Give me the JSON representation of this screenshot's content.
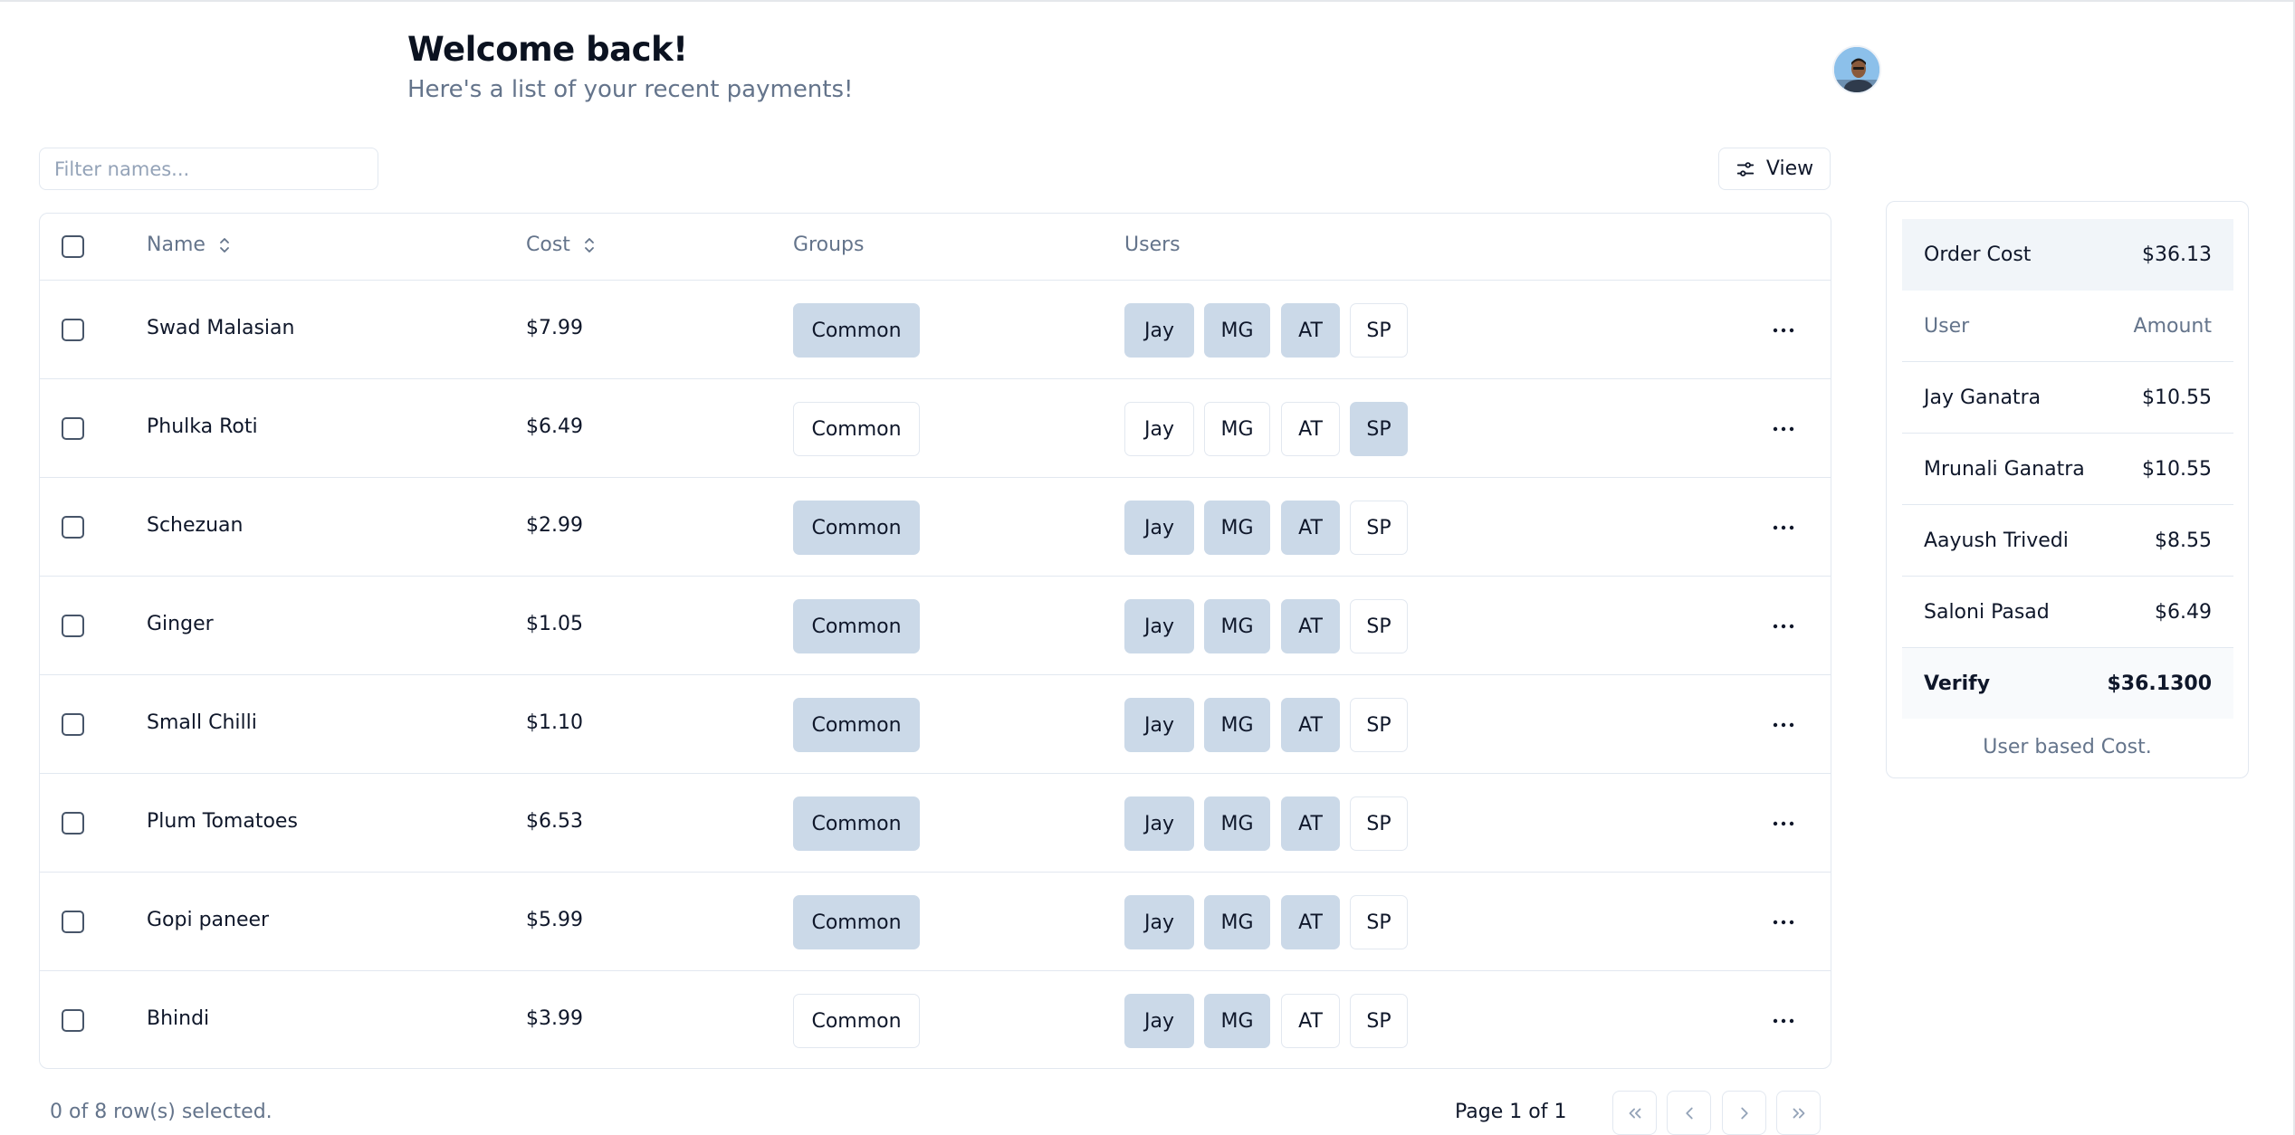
{
  "header": {
    "title": "Welcome back!",
    "subtitle": "Here's a list of your recent payments!"
  },
  "toolbar": {
    "filter_placeholder": "Filter names...",
    "view_label": "View"
  },
  "table": {
    "columns": [
      "Name",
      "Cost",
      "Groups",
      "Users"
    ],
    "user_labels": [
      "Jay",
      "MG",
      "AT",
      "SP"
    ],
    "rows": [
      {
        "name": "Swad Malasian",
        "cost": "$7.99",
        "group": "Common",
        "group_on": true,
        "users_on": [
          true,
          true,
          true,
          false
        ]
      },
      {
        "name": "Phulka Roti",
        "cost": "$6.49",
        "group": "Common",
        "group_on": false,
        "users_on": [
          false,
          false,
          false,
          true
        ]
      },
      {
        "name": "Schezuan",
        "cost": "$2.99",
        "group": "Common",
        "group_on": true,
        "users_on": [
          true,
          true,
          true,
          false
        ]
      },
      {
        "name": "Ginger",
        "cost": "$1.05",
        "group": "Common",
        "group_on": true,
        "users_on": [
          true,
          true,
          true,
          false
        ]
      },
      {
        "name": "Small Chilli",
        "cost": "$1.10",
        "group": "Common",
        "group_on": true,
        "users_on": [
          true,
          true,
          true,
          false
        ]
      },
      {
        "name": "Plum Tomatoes",
        "cost": "$6.53",
        "group": "Common",
        "group_on": true,
        "users_on": [
          true,
          true,
          true,
          false
        ]
      },
      {
        "name": "Gopi paneer",
        "cost": "$5.99",
        "group": "Common",
        "group_on": true,
        "users_on": [
          true,
          true,
          true,
          false
        ]
      },
      {
        "name": "Bhindi",
        "cost": "$3.99",
        "group": "Common",
        "group_on": false,
        "users_on": [
          true,
          true,
          false,
          false
        ]
      }
    ]
  },
  "footer": {
    "selection_text": "0 of 8 row(s) selected.",
    "page_text": "Page 1 of 1"
  },
  "summary": {
    "order_cost_label": "Order Cost",
    "order_cost_value": "$36.13",
    "col_user": "User",
    "col_amount": "Amount",
    "items": [
      {
        "user": "Jay Ganatra",
        "amount": "$10.55"
      },
      {
        "user": "Mrunali Ganatra",
        "amount": "$10.55"
      },
      {
        "user": "Aayush Trivedi",
        "amount": "$8.55"
      },
      {
        "user": "Saloni Pasad",
        "amount": "$6.49"
      }
    ],
    "verify_label": "Verify",
    "verify_value": "$36.1300",
    "caption": "User based Cost."
  },
  "colors": {
    "accent_fill": "#cbd9e8",
    "border": "#e2e8f0",
    "muted_text": "#64748b"
  },
  "icons": [
    "settings-sliders-icon",
    "sort-icon",
    "ellipsis-icon",
    "chevrons-left-icon",
    "chevron-left-icon",
    "chevron-right-icon",
    "chevrons-right-icon"
  ]
}
